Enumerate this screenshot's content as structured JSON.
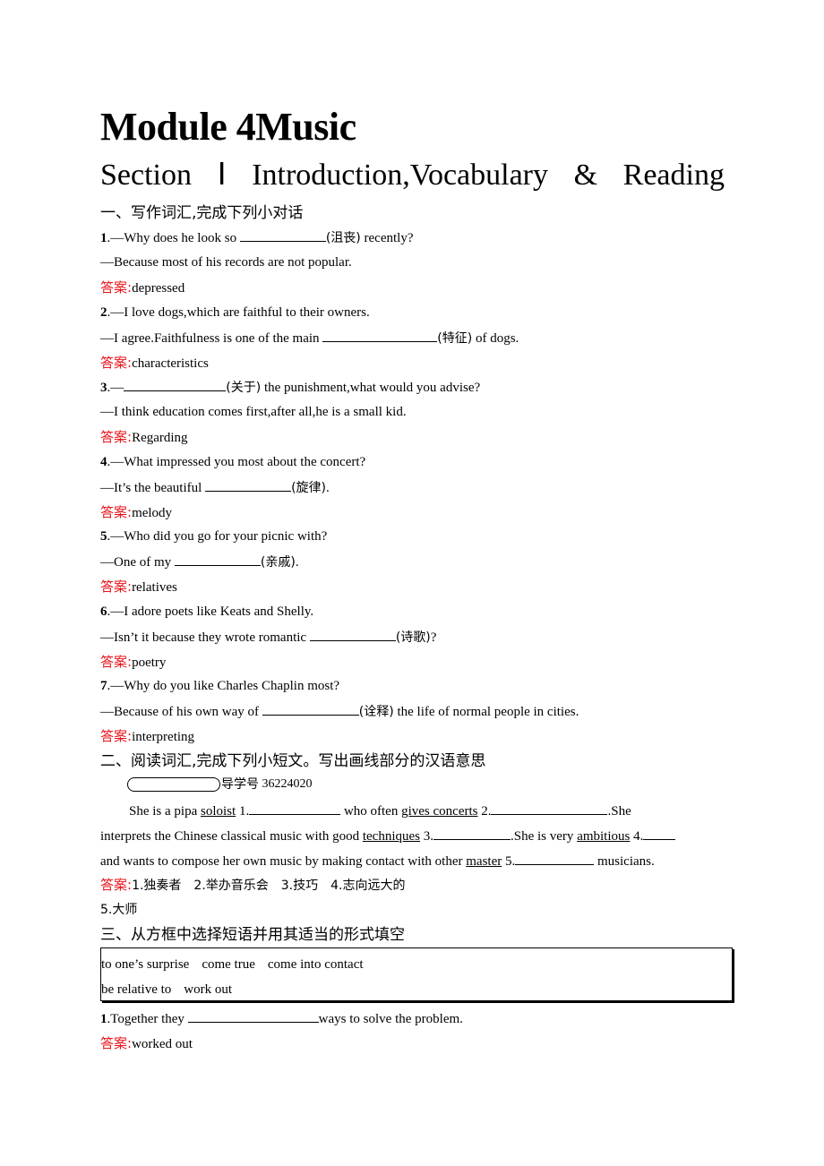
{
  "header": {
    "title": "Module 4Music",
    "subtitle_parts": [
      "Section",
      "Ⅰ",
      "Introduction,Vocabulary",
      "&",
      "Reading"
    ]
  },
  "answer_label": "答案:",
  "part1": {
    "heading": "一、写作词汇,完成下列小对话",
    "items": [
      {
        "num": "1",
        "q_pre": ".—Why does he look so ",
        "hint": "(沮丧)",
        "q_post": " recently?",
        "reply": "—Because most of his records are not popular.",
        "answer": "depressed"
      },
      {
        "num": "2",
        "q": ".—I love dogs,which are faithful to their owners.",
        "r_pre": "—I agree.Faithfulness is one of the main ",
        "hint": "(特征)",
        "r_post": " of dogs.",
        "answer": "characteristics"
      },
      {
        "num": "3",
        "q_pre": ".—",
        "hint": "(关于)",
        "q_post": " the punishment,what would you advise?",
        "reply": "—I think education comes first,after all,he is a small kid.",
        "answer": "Regarding"
      },
      {
        "num": "4",
        "q": ".—What impressed you most about the concert?",
        "r_pre": "—It’s the beautiful ",
        "hint": "(旋律)",
        "r_post": ".",
        "answer": "melody"
      },
      {
        "num": "5",
        "q": ".—Who did you go for your picnic with?",
        "r_pre": "—One of my ",
        "hint": "(亲戚)",
        "r_post": ".",
        "answer": "relatives"
      },
      {
        "num": "6",
        "q": ".—I adore poets like Keats and Shelly.",
        "r_pre": "—Isn’t it because they wrote romantic ",
        "hint": "(诗歌)",
        "r_post": "?",
        "answer": "poetry"
      },
      {
        "num": "7",
        "q": ".—Why do you like Charles Chaplin most?",
        "r_pre": "—Because of his own way of ",
        "hint": "(诠释)",
        "r_post": " the life of normal people in cities.",
        "answer": "interpreting"
      }
    ]
  },
  "part2": {
    "heading": "二、阅读词汇,完成下列小短文。写出画线部分的汉语意思",
    "guide_label": "导学号",
    "guide_number": "36224020",
    "passage": {
      "l1": [
        "She is a pipa ",
        "soloist",
        " 1.",
        " who often ",
        "gives concerts",
        " 2.",
        ".She"
      ],
      "l2": [
        "interprets the Chinese classical music with good ",
        "techniques",
        " 3.",
        ".She is very ",
        "ambitious",
        " 4."
      ],
      "l3": [
        "and wants to compose her own music by making contact with other ",
        "master",
        " 5.",
        " musicians."
      ]
    },
    "answer_line1": "1.独奏者　2.举办音乐会　3.技巧　4.志向远大的",
    "answer_line2": "5.大师"
  },
  "part3": {
    "heading": "三、从方框中选择短语并用其适当的形式填空",
    "box_row1": [
      "to one’s surprise",
      "come true",
      "come into contact"
    ],
    "box_row2": [
      "be relative to",
      "work out"
    ],
    "items": [
      {
        "num": "1",
        "pre": ".Together they ",
        "post": "ways to solve the problem.",
        "answer": "worked out"
      }
    ]
  },
  "colors": {
    "answer_label": "#e8141b",
    "text": "#000000"
  }
}
